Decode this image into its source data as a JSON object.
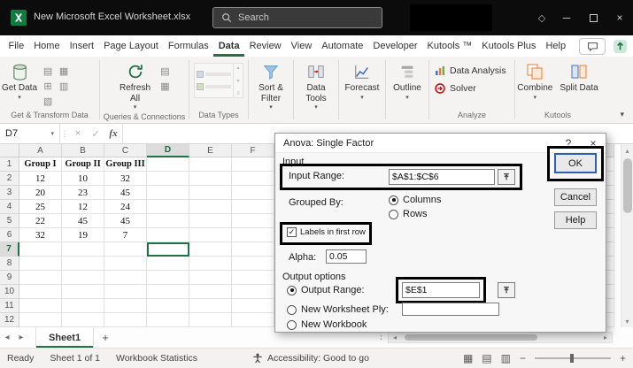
{
  "titlebar": {
    "title": "New Microsoft Excel Worksheet.xlsx",
    "search_placeholder": "Search"
  },
  "menubar": {
    "items": [
      "File",
      "Home",
      "Insert",
      "Page Layout",
      "Formulas",
      "Data",
      "Review",
      "View",
      "Automate",
      "Developer",
      "Kutools ™",
      "Kutools Plus",
      "Help"
    ],
    "active": "Data"
  },
  "ribbon": {
    "get_data": "Get Data",
    "refresh_all": "Refresh All",
    "sort_filter": "Sort & Filter",
    "data_tools": "Data Tools",
    "forecast": "Forecast",
    "outline": "Outline",
    "data_analysis": "Data Analysis",
    "solver": "Solver",
    "combine": "Combine",
    "split_data": "Split Data",
    "groups": {
      "get_transform": "Get & Transform Data",
      "queries": "Queries & Connections",
      "data_types": "Data Types",
      "analyze": "Analyze",
      "kutools": "Kutools"
    }
  },
  "formula_bar": {
    "name_box": "D7",
    "fx": "fx"
  },
  "grid": {
    "columns": [
      "A",
      "B",
      "C",
      "D",
      "E",
      "F"
    ],
    "row_count": 12,
    "selected_cell": "D7",
    "data": [
      [
        "Group I",
        "Group II",
        "Group III"
      ],
      [
        "12",
        "10",
        "32"
      ],
      [
        "20",
        "23",
        "45"
      ],
      [
        "25",
        "12",
        "24"
      ],
      [
        "22",
        "45",
        "45"
      ],
      [
        "32",
        "19",
        "7"
      ]
    ]
  },
  "dialog": {
    "title": "Anova: Single Factor",
    "input_section": "Input",
    "input_range_label": "Input Range:",
    "input_range_value": "$A$1:$C$6",
    "grouped_by_label": "Grouped By:",
    "columns_option": "Columns",
    "rows_option": "Rows",
    "labels_checkbox": "Labels in first row",
    "alpha_label": "Alpha:",
    "alpha_value": "0.05",
    "output_section": "Output options",
    "output_range_label": "Output Range:",
    "output_range_value": "$E$1",
    "new_worksheet_label": "New Worksheet Ply:",
    "new_workbook_label": "New Workbook",
    "ok": "OK",
    "cancel": "Cancel",
    "help": "Help"
  },
  "sheetbar": {
    "sheet_tab": "Sheet1"
  },
  "statusbar": {
    "ready": "Ready",
    "sheet_count": "Sheet 1 of 1",
    "workbook_statistics": "Workbook Statistics",
    "accessibility": "Accessibility: Good to go"
  },
  "colors": {
    "excel_green": "#217346",
    "titlebar_black": "#0c0c0c",
    "highlight_annotation": "#000000",
    "ok_focus_blue": "#2f5fb3"
  },
  "icons": {
    "chevron_down": "▾",
    "close": "×",
    "minimize": "─",
    "question": "?",
    "check": "✓",
    "formula_cancel": "×",
    "dots": "⋮",
    "left": "◂",
    "right": "▸",
    "up": "▴",
    "down": "▾",
    "plus": "+",
    "diamond": "◇",
    "grid_a": "▤",
    "grid_b": "▦",
    "grid_c": "⊞",
    "grid_d": "▥",
    "grid_e": "▧",
    "view_normal": "▦",
    "view_layout": "▤",
    "view_break": "▥",
    "zoom_out": "−",
    "zoom_in": "+",
    "lines": "≡"
  }
}
